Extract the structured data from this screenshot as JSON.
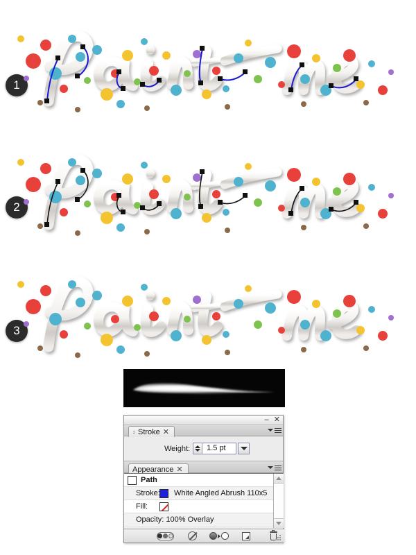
{
  "artwork": {
    "text": "Paint me",
    "description": "Paint-splattered 3D script lettering reading 'Paint me'",
    "steps": [
      {
        "number": "1",
        "path_color": "#1a1ad0",
        "paths_visible": true,
        "anchors_visible": true
      },
      {
        "number": "2",
        "path_color": "#111111",
        "paths_visible": true,
        "anchors_visible": true
      },
      {
        "number": "3",
        "path_color": "#111111",
        "paths_visible": false,
        "anchors_visible": false
      }
    ],
    "splatter_colors": [
      "#e8413c",
      "#4fb3d0",
      "#f4c430",
      "#7ec24f",
      "#a06fd0",
      "#8a6a4a",
      "#2f8fb5"
    ]
  },
  "brush_preview": {
    "name": "White Angled Abrush 110x5 preview",
    "background": "#050505",
    "stroke_color": "#ffffff"
  },
  "panel_group": {
    "titlebar": {
      "minimize_label": "–",
      "close_label": "✕"
    },
    "stroke_panel": {
      "tab_label": "Stroke",
      "tab_close_label": "✕",
      "anchor_icon": "double-arrow-icon",
      "menu_icon": "panel-menu-icon",
      "weight": {
        "label": "Weight:",
        "value": "1.5 pt",
        "stepper_icon": "spinner-arrows-icon",
        "dropdown_icon": "chevron-down-icon"
      }
    },
    "appearance_panel": {
      "tab_label": "Appearance",
      "tab_close_label": "✕",
      "menu_icon": "panel-menu-icon",
      "rows": [
        {
          "kind": "object",
          "name": "Path",
          "swatch": "#ffffff"
        },
        {
          "kind": "stroke",
          "label": "Stroke:",
          "chip_color": "#1c20d8",
          "value": "White Angled Abrush 110x5"
        },
        {
          "kind": "fill",
          "label": "Fill:",
          "chip_color": "#ffffff",
          "value": ""
        },
        {
          "kind": "opacity",
          "label": "",
          "value": "Opacity: 100% Overlay"
        }
      ],
      "scrollbar": {
        "up_icon": "scroll-up-arrow-icon",
        "down_icon": "scroll-down-arrow-icon"
      },
      "footer_buttons": [
        {
          "name": "add-new-stroke-button",
          "icon": "appearance-toggle-pill-icon"
        },
        {
          "name": "clear-appearance-button",
          "icon": "no-symbol-icon"
        },
        {
          "name": "reduce-to-basic-appearance-button",
          "icon": "two-circles-arrow-icon"
        },
        {
          "name": "duplicate-selected-item-button",
          "icon": "duplicate-square-icon"
        },
        {
          "name": "delete-selected-item-button",
          "icon": "trash-icon"
        }
      ]
    }
  }
}
